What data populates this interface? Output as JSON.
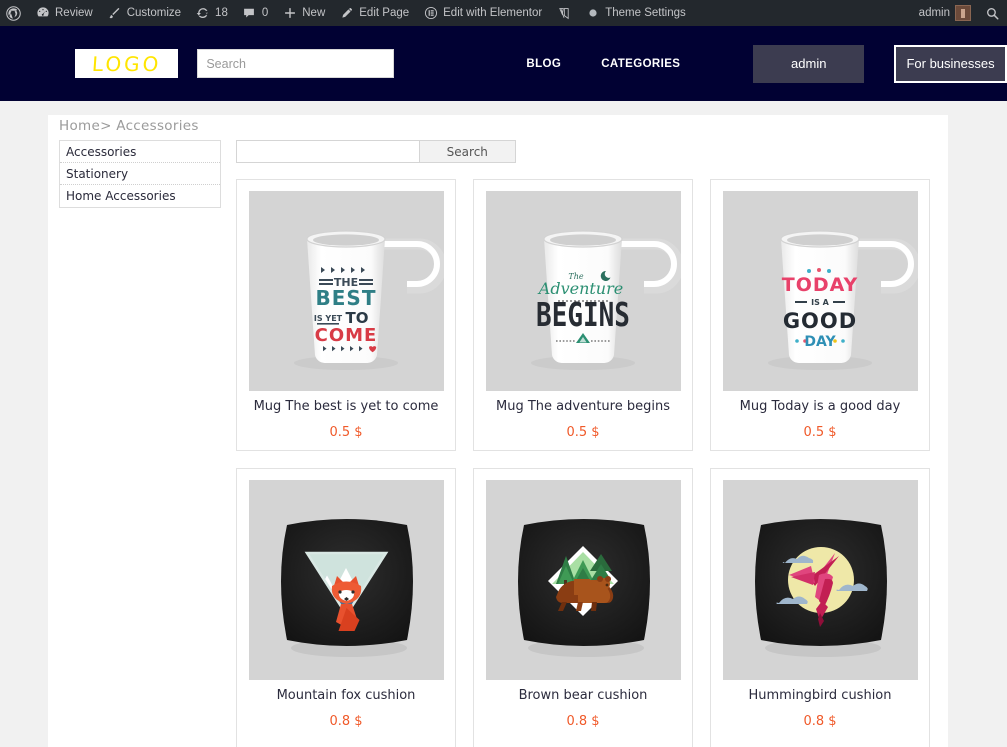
{
  "adminbar": {
    "items": [
      {
        "icon": "wordpress-logo-icon",
        "label": ""
      },
      {
        "icon": "dashboard-icon",
        "label": "Review"
      },
      {
        "icon": "paintbrush-icon",
        "label": "Customize"
      },
      {
        "icon": "updates-icon",
        "label": "18"
      },
      {
        "icon": "comment-icon",
        "label": "0"
      },
      {
        "icon": "plus-icon",
        "label": "New"
      },
      {
        "icon": "pencil-icon",
        "label": "Edit Page"
      },
      {
        "icon": "elementor-icon",
        "label": "Edit with Elementor"
      },
      {
        "icon": "wpbakery-icon",
        "label": ""
      },
      {
        "icon": "circle-icon",
        "label": "Theme Settings"
      }
    ],
    "account": "admin",
    "search_icon": "search-icon"
  },
  "header": {
    "logo_text": "LOGO",
    "search_placeholder": "Search",
    "search_value": "",
    "nav": [
      {
        "label": "BLOG"
      },
      {
        "label": "CATEGORIES"
      }
    ],
    "admin_button": "admin",
    "business_button": "For businesses",
    "bg_color": "#010133",
    "button_color": "#3c3c50"
  },
  "breadcrumb": "Home> Accessories",
  "sidebar": {
    "items": [
      {
        "label": "Accessories"
      },
      {
        "label": "Stationery"
      },
      {
        "label": "Home Accessories"
      }
    ]
  },
  "search": {
    "value": "",
    "placeholder": "",
    "button_label": "Search"
  },
  "products": [
    {
      "title": "Mug The best is yet to come",
      "price": "0.5 $",
      "image": "mug-best-is-yet-to-come"
    },
    {
      "title": "Mug The adventure begins",
      "price": "0.5 $",
      "image": "mug-adventure-begins"
    },
    {
      "title": "Mug Today is a good day",
      "price": "0.5 $",
      "image": "mug-today-is-a-good-day"
    },
    {
      "title": "Mountain fox cushion",
      "price": "0.8 $",
      "image": "cushion-mountain-fox"
    },
    {
      "title": "Brown bear cushion",
      "price": "0.8 $",
      "image": "cushion-brown-bear"
    },
    {
      "title": "Hummingbird cushion",
      "price": "0.8 $",
      "image": "cushion-hummingbird"
    }
  ],
  "colors": {
    "price": "#f05a2a",
    "adminbar": "#23282d",
    "page_bg": "#f1f1f1",
    "thumb_bg": "#d4d4d4"
  }
}
